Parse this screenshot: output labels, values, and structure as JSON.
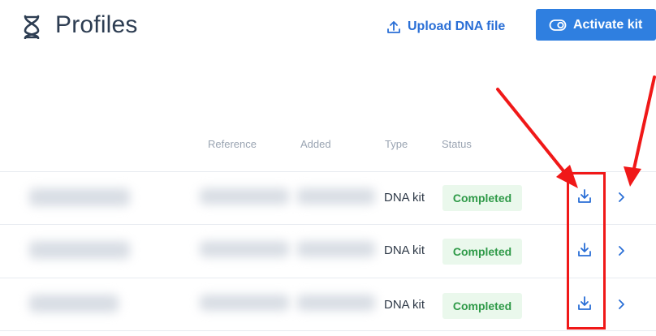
{
  "header": {
    "title": "Profiles",
    "logo_icon": "dna-icon",
    "upload_label": "Upload DNA file",
    "upload_icon": "upload-icon",
    "activate_label": "Activate kit",
    "activate_icon": "toggle-icon"
  },
  "table": {
    "columns": [
      "Reference",
      "Added",
      "Type",
      "Status"
    ],
    "rows": [
      {
        "type": "DNA kit",
        "status": "Completed"
      },
      {
        "type": "DNA kit",
        "status": "Completed"
      },
      {
        "type": "DNA kit",
        "status": "Completed"
      }
    ]
  },
  "colors": {
    "accent": "#2f7fe0",
    "link": "#2a6fd6",
    "status_text": "#2f9a48",
    "status_bg": "#eaf8ec",
    "annotation": "#f01818"
  }
}
